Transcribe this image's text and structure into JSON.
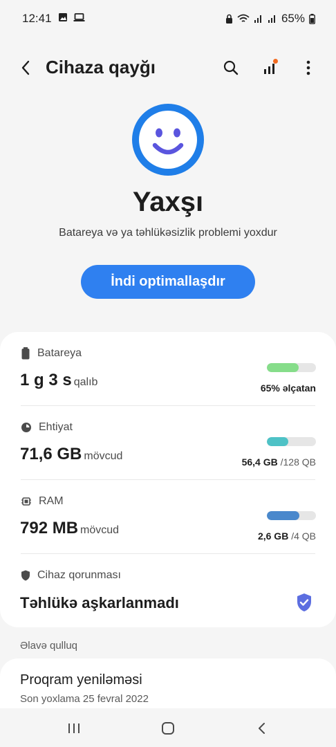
{
  "status_bar": {
    "time": "12:41",
    "battery": "65%",
    "icons": [
      "image-icon",
      "laptop-icon",
      "lock-icon",
      "wifi-icon",
      "signal-icon",
      "signal-icon",
      "battery-icon"
    ]
  },
  "app_bar": {
    "title": "Cihaza qayğı",
    "actions": [
      "search-icon",
      "stats-icon",
      "more-vert-icon"
    ]
  },
  "summary": {
    "icon": "smiley-face-icon",
    "title": "Yaxşı",
    "subtitle": "Batareya və ya təhlükəsizlik problemi yoxdur",
    "button": "İndi optimallaşdır"
  },
  "battery": {
    "icon": "battery-icon",
    "label": "Batareya",
    "value": "1 g 3 s",
    "unit": "qalıb",
    "bar_fraction": 0.65,
    "bar_color": "#86dd8a",
    "right_value": "65% əlçatan",
    "right_total": ""
  },
  "storage": {
    "icon": "storage-pie-icon",
    "label": "Ehtiyat",
    "value": "71,6 GB",
    "unit": "mövcud",
    "bar_fraction": 0.44,
    "bar_color": "#4ec2c6",
    "right_value": "56,4 GB",
    "right_total": "/128 QB"
  },
  "ram": {
    "icon": "memory-chip-icon",
    "label": "RAM",
    "value": "792 MB",
    "unit": "mövcud",
    "bar_fraction": 0.66,
    "bar_color": "#4a88cc",
    "right_value": "2,6 GB",
    "right_total": "/4 QB"
  },
  "protection": {
    "icon": "shield-icon",
    "label": "Cihaz qorunması",
    "value": "Təhlükə aşkarlanmadı",
    "badge_icon": "shield-check-icon",
    "badge_color": "#5c6ee0"
  },
  "extra": {
    "section_label": "Əlavə qulluq",
    "item_title": "Proqram yeniləməsi",
    "item_sub": "Son yoxlama 25 fevral 2022"
  },
  "nav": [
    "recent-apps-icon",
    "home-icon",
    "back-icon"
  ],
  "colors": {
    "accent": "#2f80f0",
    "background": "#f5f5f5",
    "card": "#ffffff"
  }
}
